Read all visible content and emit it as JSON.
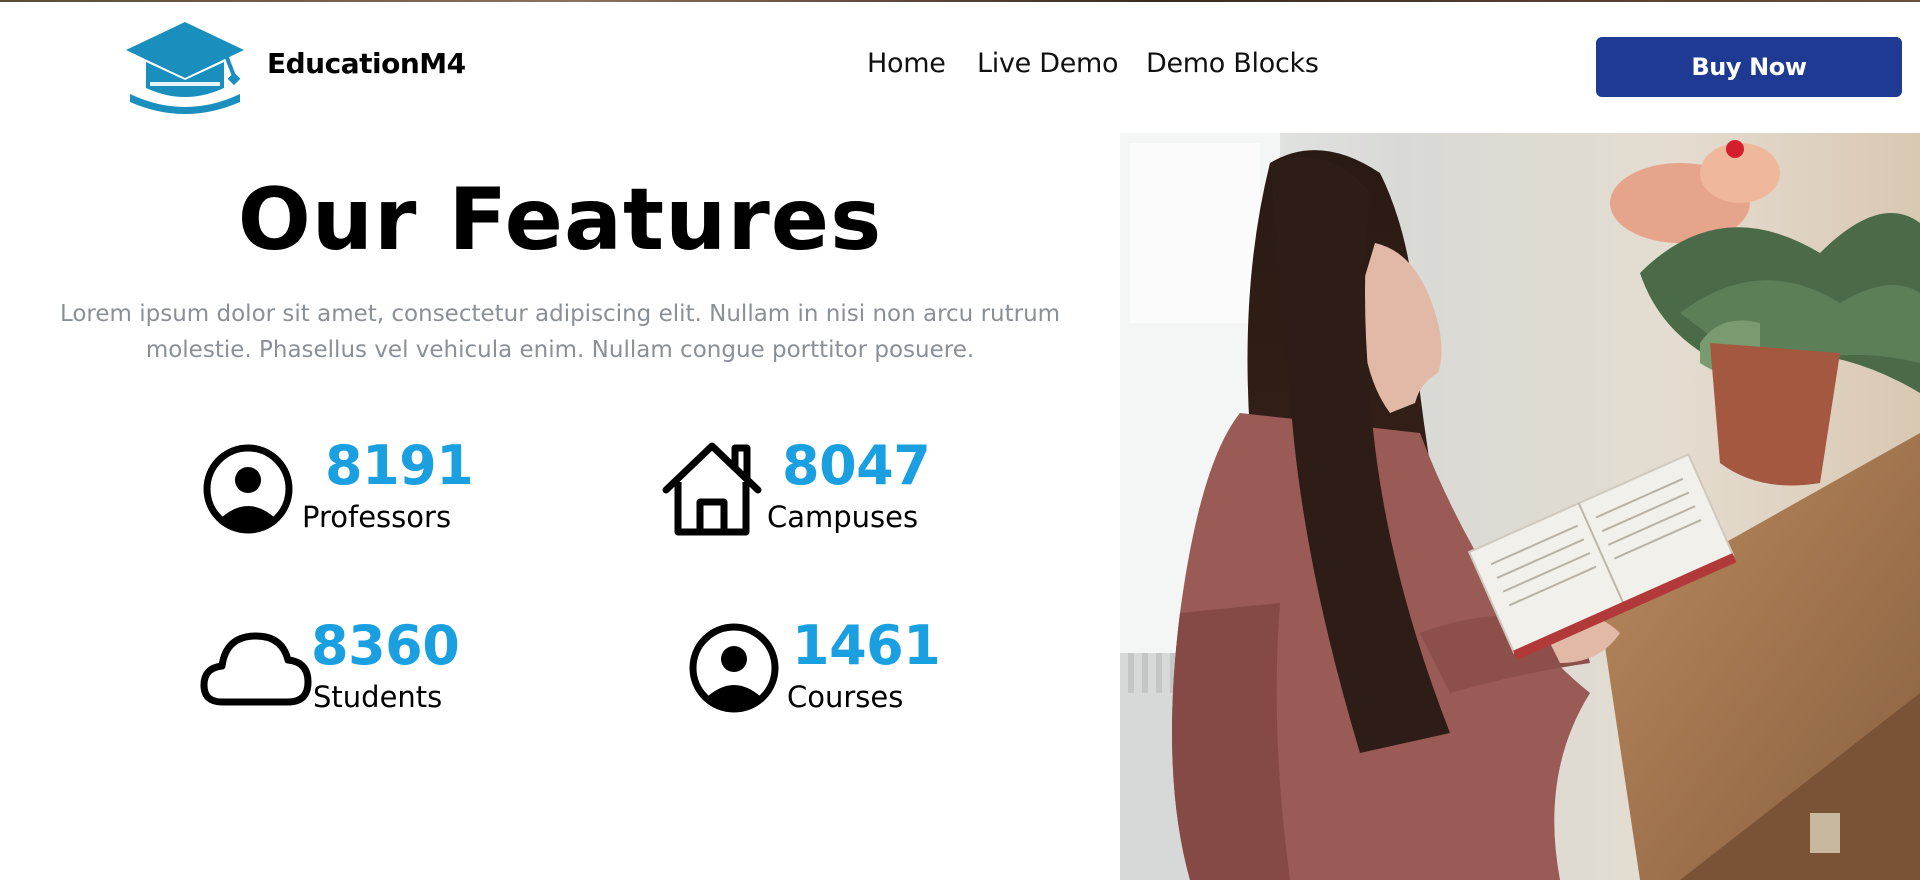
{
  "header": {
    "brand": "EducationM4",
    "nav": [
      "Home",
      "Live Demo",
      "Demo Blocks"
    ],
    "buy_label": "Buy Now",
    "logo_icon": "graduation-cap-icon"
  },
  "hero": {
    "title": "Our Features",
    "description_line1": "Lorem ipsum dolor sit amet, consectetur adipiscing elit. Nullam in nisi non arcu rutrum",
    "description_line2": "molestie. Phasellus vel vehicula enim. Nullam congue porttitor posuere."
  },
  "features": [
    {
      "value": "8191",
      "label": "Professors",
      "icon": "user-circle-icon"
    },
    {
      "value": "8047",
      "label": "Campuses",
      "icon": "house-icon"
    },
    {
      "value": "8360",
      "label": "Students",
      "icon": "cloud-icon"
    },
    {
      "value": "1461",
      "label": "Courses",
      "icon": "user-circle-icon"
    }
  ],
  "colors": {
    "brand_blue": "#1a8fbd",
    "button": "#1f3a93",
    "stat_number": "#1aa0e0",
    "description": "#8a9097"
  }
}
